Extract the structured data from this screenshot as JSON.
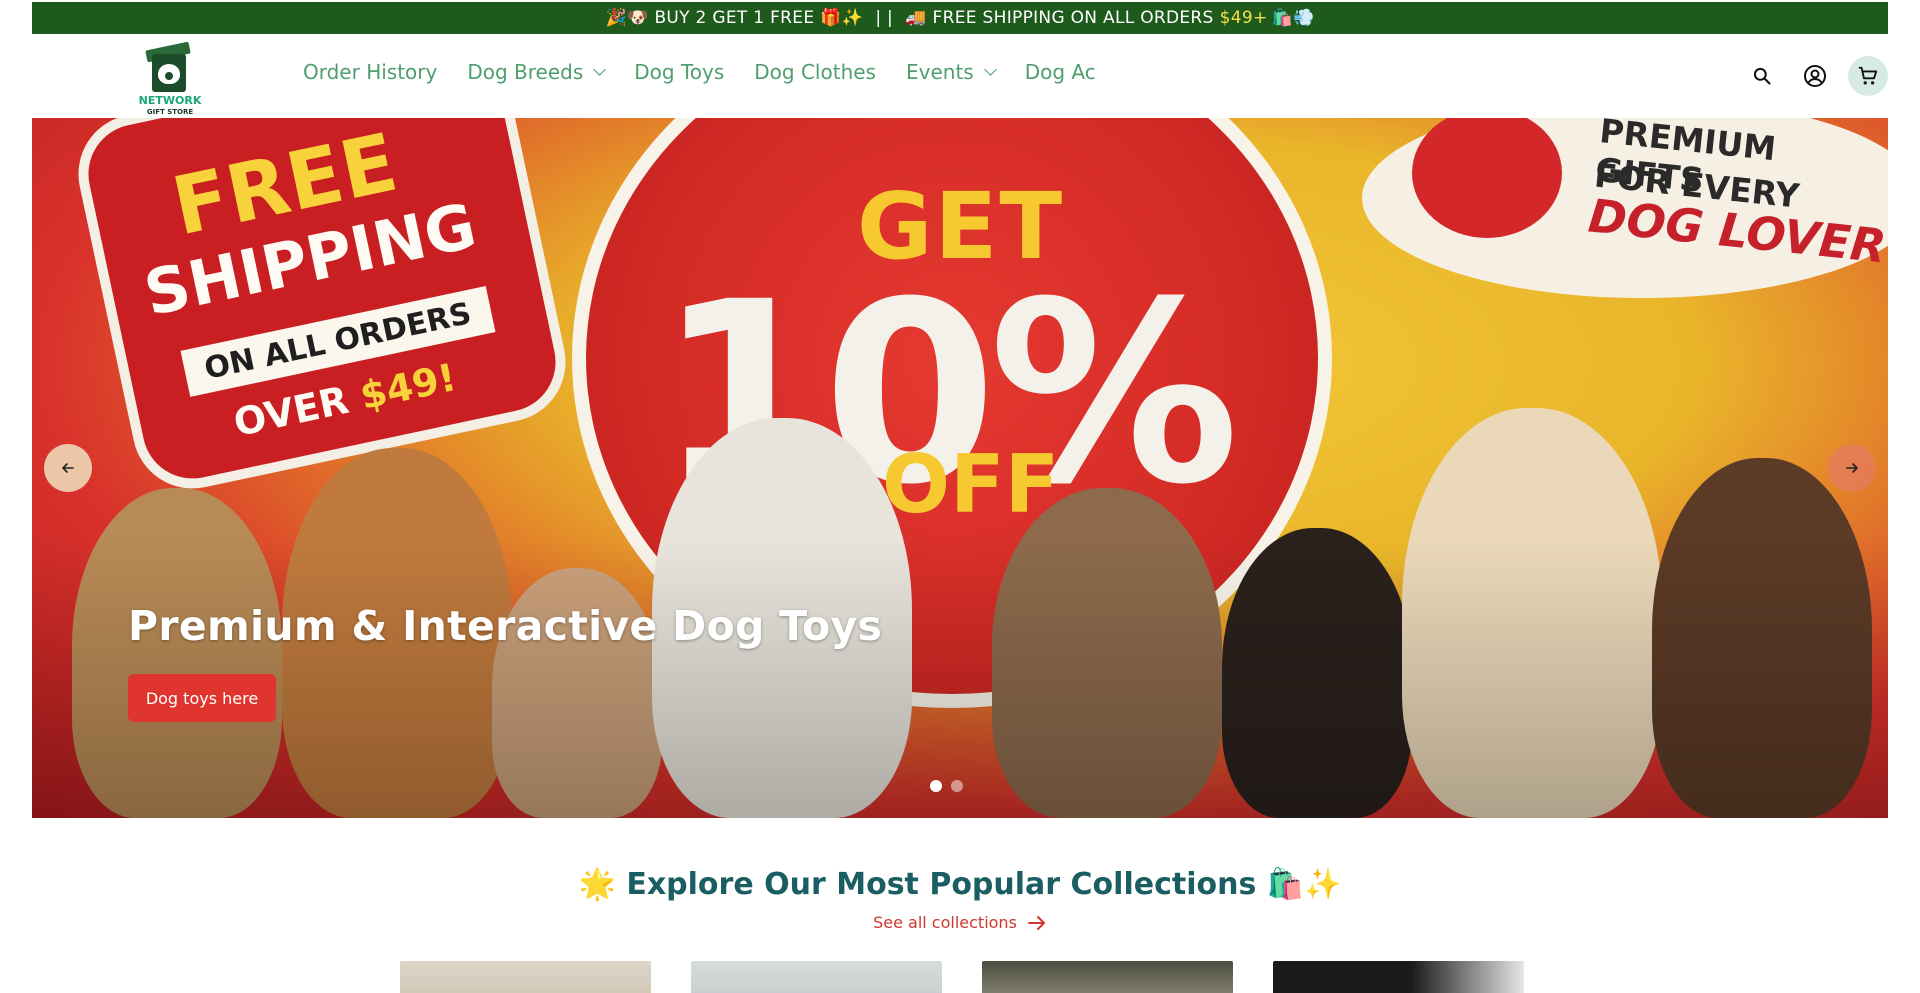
{
  "announcement": {
    "left_emoji": "🎉🐶",
    "offer": "BUY 2 GET 1 FREE",
    "offer_emoji": "🎁✨",
    "separator": "| |",
    "truck_emoji": "🚚",
    "shipping": "FREE SHIPPING ON ALL ORDERS",
    "price": "$49+",
    "end_emoji": "🛍️💨",
    "bg_color": "#1e5a1c",
    "price_color": "#f4e14a"
  },
  "logo": {
    "line1": "NETWORK",
    "line2": "GIFT STORE"
  },
  "nav": {
    "items": [
      {
        "label": "Order History",
        "dropdown": false
      },
      {
        "label": "Dog Breeds",
        "dropdown": true
      },
      {
        "label": "Dog Toys",
        "dropdown": false
      },
      {
        "label": "Dog Clothes",
        "dropdown": false
      },
      {
        "label": "Events",
        "dropdown": true
      },
      {
        "label": "Dog Ac",
        "dropdown": false
      }
    ],
    "color": "#4e9e6e"
  },
  "header_icons": [
    "search-icon",
    "account-icon",
    "cart-icon"
  ],
  "hero": {
    "banner": {
      "free": "FREE",
      "shipping": "SHIPPING",
      "on_all_orders": "ON ALL ORDERS",
      "over": "OVER",
      "over_amount": "$49!",
      "get": "GET",
      "percent": "10%",
      "off": "OFF",
      "premium_line1": "PREMIUM GIFTS",
      "premium_line2": "FOR EVERY",
      "premium_line3": "DOG LOVER"
    },
    "title": "Premium & Interactive Dog Toys",
    "button_label": "Dog toys here",
    "button_color": "#e0352f",
    "slides": 2,
    "active_slide": 1
  },
  "collections": {
    "title": "🌟 Explore Our Most Popular Collections 🛍️✨",
    "link_label": "See all collections",
    "title_color": "#1a5d63",
    "link_color": "#d0362d"
  }
}
